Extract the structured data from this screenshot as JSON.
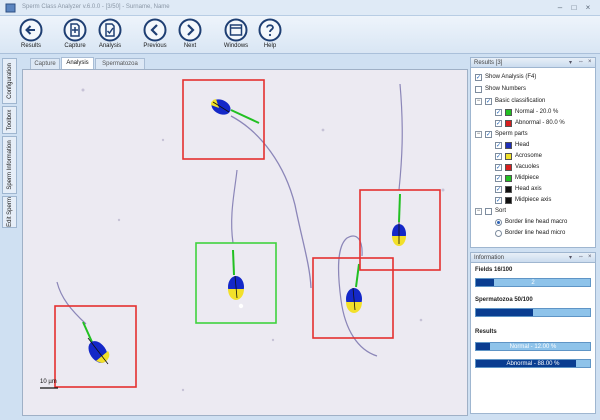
{
  "window": {
    "title": "Sperm Class Analyzer v.6.0.0 - [3/50] - Surname, Name"
  },
  "toolbar": {
    "buttons": [
      {
        "label": "Results"
      },
      {
        "label": "Capture"
      },
      {
        "label": "Analysis"
      },
      {
        "label": "Previous"
      },
      {
        "label": "Next"
      },
      {
        "label": "Windows"
      },
      {
        "label": "Help"
      }
    ]
  },
  "side_tabs": [
    "Configuration",
    "Toolbox",
    "Sperm Information",
    "Edit Sperm"
  ],
  "doc_tabs": [
    {
      "label": "Capture"
    },
    {
      "label": "Analysis",
      "active": true
    },
    {
      "label": "Spermatozoa"
    }
  ],
  "image": {
    "scale_label": "10 µm",
    "colors": {
      "normal_box": "#3fd23f",
      "abnormal_box": "#e53030",
      "head": "#1428c8",
      "acrosome": "#f2e02a",
      "midpiece": "#22c022",
      "background": "#eceaf2"
    },
    "cells": [
      {
        "classification": "abnormal"
      },
      {
        "classification": "abnormal"
      },
      {
        "classification": "normal"
      },
      {
        "classification": "abnormal"
      },
      {
        "classification": "abnormal"
      }
    ]
  },
  "results_panel": {
    "title": "Results [3]",
    "show_analysis": "Show Analysis (F4)",
    "show_numbers": "Show Numbers",
    "basic_classification": "Basic classification",
    "normal": "Normal - 20.0 %",
    "abnormal": "Abnormal - 80.0 %",
    "sperm_parts": "Sperm parts",
    "parts": [
      "Head",
      "Acrosome",
      "Vacuoles",
      "Midpiece",
      "Head axis",
      "Midpiece axis"
    ],
    "sort": "Sort",
    "sort_options": [
      "Border line head macro",
      "Border line head micro"
    ],
    "colors": {
      "normal": "#22c022",
      "abnormal": "#d81e1e",
      "head": "#1f2fb8",
      "acrosome": "#f0e02a",
      "vacuoles": "#d81e1e",
      "midpiece": "#22c022",
      "head_axis": "#111111",
      "midpiece_axis": "#111111"
    }
  },
  "info_panel": {
    "title": "Information",
    "fields_label": "Fields 16/100",
    "fields_value": "2",
    "fields_progress": 0.16,
    "spermatozoa_label": "Spermatozoa 50/100",
    "spermatozoa_progress": 0.5,
    "results_label": "Results",
    "normal_bar": "Normal - 12.00 %",
    "normal_progress": 0.12,
    "abnormal_bar": "Abnormal - 88.00 %",
    "abnormal_progress": 0.88
  }
}
